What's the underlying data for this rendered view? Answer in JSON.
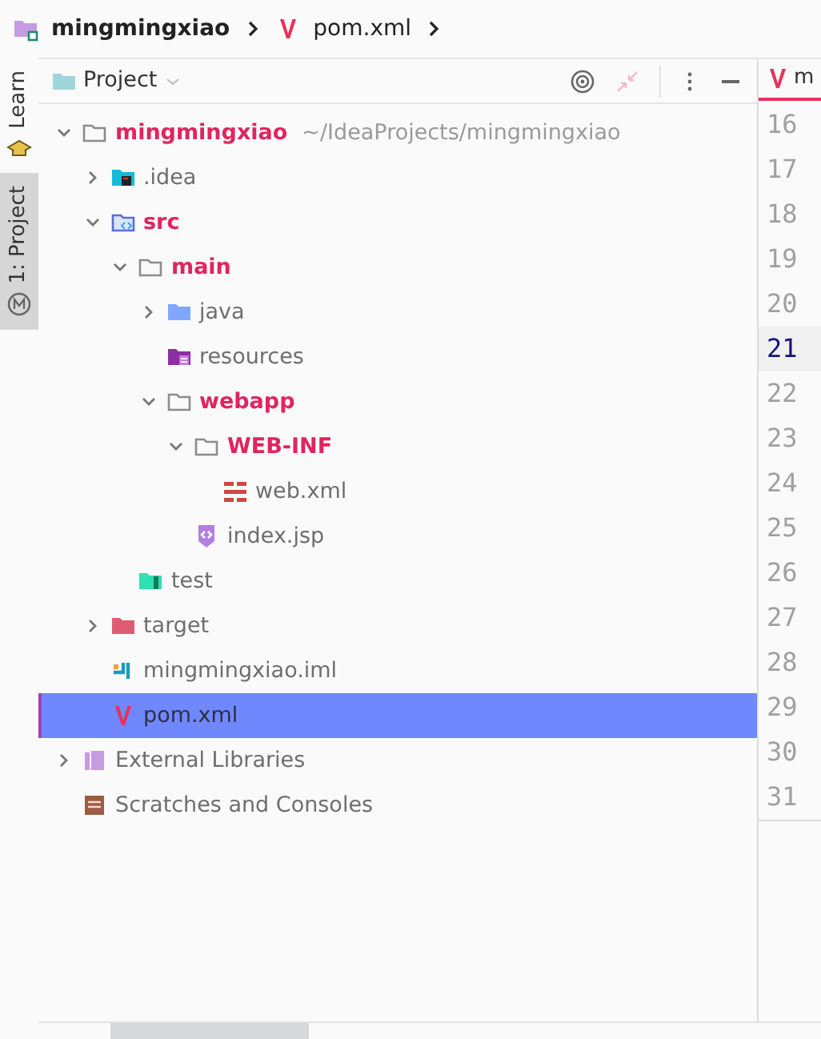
{
  "breadcrumbs": [
    {
      "label": "mingmingxiao",
      "kind": "module"
    },
    {
      "label": "pom.xml",
      "kind": "maven"
    }
  ],
  "side_tabs": [
    {
      "label": "Learn",
      "kind": "learn",
      "selected": false
    },
    {
      "label": "1: Project",
      "kind": "maven-m",
      "selected": true
    }
  ],
  "panel": {
    "title": "Project"
  },
  "tree": [
    {
      "label": "mingmingxiao",
      "path": "~/IdeaProjects/mingmingxiao",
      "kind": "folder",
      "highlighted": true,
      "selected": false,
      "expanded": true,
      "children": [
        {
          "label": ".idea",
          "kind": "idea",
          "highlighted": false,
          "selected": false,
          "expanded": false
        },
        {
          "label": "src",
          "kind": "src",
          "highlighted": true,
          "selected": false,
          "expanded": true,
          "children": [
            {
              "label": "main",
              "kind": "folder",
              "highlighted": true,
              "selected": false,
              "expanded": true,
              "children": [
                {
                  "label": "java",
                  "kind": "java",
                  "highlighted": false,
                  "selected": false,
                  "expanded": false
                },
                {
                  "label": "resources",
                  "kind": "resources",
                  "highlighted": false,
                  "selected": false
                },
                {
                  "label": "webapp",
                  "kind": "folder",
                  "highlighted": true,
                  "selected": false,
                  "expanded": true,
                  "children": [
                    {
                      "label": "WEB-INF",
                      "kind": "folder",
                      "highlighted": true,
                      "selected": false,
                      "expanded": true,
                      "children": [
                        {
                          "label": "web.xml",
                          "kind": "xml",
                          "highlighted": false,
                          "selected": false
                        }
                      ]
                    },
                    {
                      "label": "index.jsp",
                      "kind": "jsp",
                      "highlighted": false,
                      "selected": false
                    }
                  ]
                }
              ]
            },
            {
              "label": "test",
              "kind": "test",
              "highlighted": false,
              "selected": false
            }
          ]
        },
        {
          "label": "target",
          "kind": "excluded",
          "highlighted": false,
          "selected": false,
          "expanded": false
        },
        {
          "label": "mingmingxiao.iml",
          "kind": "iml",
          "highlighted": false,
          "selected": false
        },
        {
          "label": "pom.xml",
          "kind": "maven",
          "highlighted": false,
          "selected": true
        }
      ]
    },
    {
      "label": "External Libraries",
      "kind": "libraries",
      "highlighted": false,
      "selected": false,
      "expanded": false
    },
    {
      "label": "Scratches and Consoles",
      "kind": "scratches",
      "highlighted": false,
      "selected": false
    }
  ],
  "editor": {
    "tab": "m",
    "lines": [
      {
        "number": "16",
        "current": false
      },
      {
        "number": "17",
        "current": false
      },
      {
        "number": "18",
        "current": false
      },
      {
        "number": "19",
        "current": false
      },
      {
        "number": "20",
        "current": false
      },
      {
        "number": "21",
        "current": true
      },
      {
        "number": "22",
        "current": false
      },
      {
        "number": "23",
        "current": false
      },
      {
        "number": "24",
        "current": false
      },
      {
        "number": "25",
        "current": false
      },
      {
        "number": "26",
        "current": false
      },
      {
        "number": "27",
        "current": false
      },
      {
        "number": "28",
        "current": false
      },
      {
        "number": "29",
        "current": false
      },
      {
        "number": "30",
        "current": false
      },
      {
        "number": "31",
        "current": false
      }
    ]
  }
}
